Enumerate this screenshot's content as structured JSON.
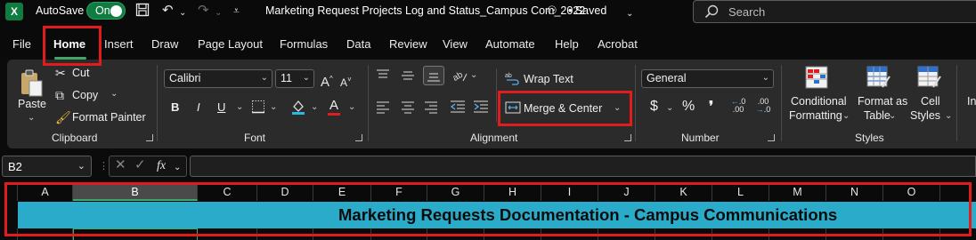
{
  "titlebar": {
    "logo": "X",
    "autosave_label": "AutoSave",
    "autosave_state": "On",
    "document_title": "Marketing Request Projects Log and Status_Campus Com_2022",
    "save_status": "• Saved",
    "search_placeholder": "Search"
  },
  "tabs": [
    "File",
    "Home",
    "Insert",
    "Draw",
    "Page Layout",
    "Formulas",
    "Data",
    "Review",
    "View",
    "Automate",
    "Help",
    "Acrobat"
  ],
  "active_tab": "Home",
  "ribbon": {
    "clipboard": {
      "label": "Clipboard",
      "paste": "Paste",
      "cut": "Cut",
      "copy": "Copy",
      "format_painter": "Format Painter"
    },
    "font": {
      "label": "Font",
      "font_name": "Calibri",
      "font_size": "11",
      "bold": "B",
      "italic": "I",
      "underline": "U",
      "font_color_glyph": "A"
    },
    "alignment": {
      "label": "Alignment",
      "wrap_text": "Wrap Text",
      "merge_center": "Merge & Center"
    },
    "number": {
      "label": "Number",
      "format": "General",
      "currency": "$",
      "percent": "%",
      "comma": "❜",
      "inc_decimal": ".00",
      "dec_decimal": ".00"
    },
    "styles": {
      "label": "Styles",
      "conditional_1": "Conditional",
      "conditional_2": "Formatting",
      "format_table_1": "Format as",
      "format_table_2": "Table",
      "cell_styles_1": "Cell",
      "cell_styles_2": "Styles",
      "truncated": "In"
    }
  },
  "formula_bar": {
    "name_box": "B2",
    "fx": "fx",
    "value": ""
  },
  "grid": {
    "columns": [
      "A",
      "B",
      "C",
      "D",
      "E",
      "F",
      "G",
      "H",
      "I",
      "J",
      "K",
      "L",
      "M",
      "N",
      "O"
    ],
    "selected_column": "B",
    "banner_text": "Marketing Requests Documentation - Campus Communications",
    "banner_color": "#29abc9"
  },
  "colors": {
    "accent": "#107c41",
    "highlight": "#e01c1c",
    "selection": "#3fa868"
  }
}
